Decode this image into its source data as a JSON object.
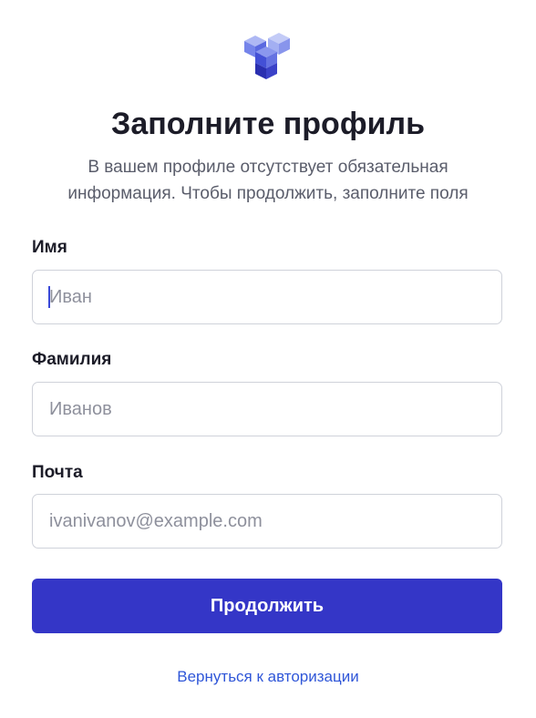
{
  "header": {
    "title": "Заполните профиль",
    "subtitle_line1": "В вашем профиле отсутствует обязательная",
    "subtitle_line2": "информация. Чтобы продолжить, заполните поля"
  },
  "form": {
    "first_name": {
      "label": "Имя",
      "value": "",
      "placeholder": "Иван"
    },
    "last_name": {
      "label": "Фамилия",
      "value": "",
      "placeholder": "Иванов"
    },
    "email": {
      "label": "Почта",
      "value": "",
      "placeholder": "ivanivanov@example.com"
    }
  },
  "actions": {
    "continue_label": "Продолжить",
    "back_link_label": "Вернуться к авторизации"
  },
  "colors": {
    "brand": "#3436c7",
    "logo_light": "#a9b3f2",
    "logo_mid": "#6b7be8",
    "logo_dark": "#2e33b8",
    "link": "#2f56d8"
  },
  "icons": {
    "logo": "cube-stack-logo-icon"
  }
}
